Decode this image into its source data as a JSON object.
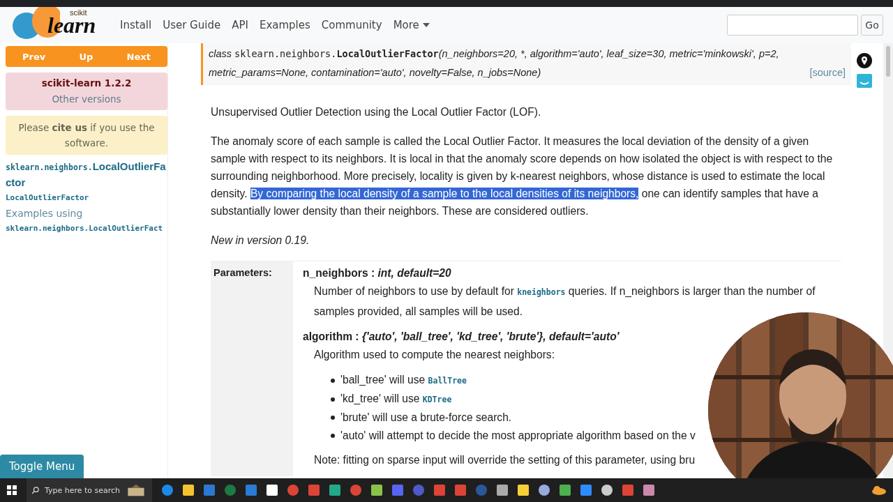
{
  "navbar": {
    "logo": {
      "small": "scikit",
      "big": "learn"
    },
    "links": [
      {
        "label": "Install"
      },
      {
        "label": "User Guide"
      },
      {
        "label": "API"
      },
      {
        "label": "Examples"
      },
      {
        "label": "Community"
      },
      {
        "label": "More",
        "kind": "dropdown"
      }
    ],
    "search": {
      "button": "Go"
    }
  },
  "sidebar": {
    "nav_buttons": [
      "Prev",
      "Up",
      "Next"
    ],
    "version": {
      "title": "scikit-learn 1.2.2",
      "link": "Other versions"
    },
    "cite": "Please **cite us** if you use the software.",
    "toc": [
      {
        "kind": "mixed",
        "mono": "sklearn.neighbors.",
        "text": "LocalOutlierFactor"
      },
      {
        "kind": "code",
        "text": "LocalOutlierFactor"
      },
      {
        "kind": "text",
        "text": "Examples using"
      },
      {
        "kind": "code",
        "text": "sklearn.neighbors.LocalOutlierFact"
      }
    ],
    "toggle": "Toggle Menu"
  },
  "signature": {
    "prefix": "class",
    "module": "sklearn.neighbors.",
    "name": "LocalOutlierFactor",
    "params": "(n_neighbors=20, *, algorithm='auto', leaf_size=30, metric='minkowski', p=2, metric_params=None, contamination='auto', novelty=False, n_jobs=None)",
    "source": "[source]"
  },
  "summary": "Unsupervised Outlier Detection using the Local Outlier Factor (LOF).",
  "description": [
    {
      "text": "The anomaly score of each sample is called the Local Outlier Factor. It measures the local deviation of the density of a given sample with respect to its neighbors. It is local in that the anomaly score depends on how isolated the object is with respect to the surrounding neighborhood. More precisely, locality is given by k-nearest neighbors, whose distance is used to estimate the local density. ",
      "selected": false
    },
    {
      "text": "By comparing the local density of a sample to the local densities of its neighbors,",
      "selected": true
    },
    {
      "text": " one can identify samples that have a substantially lower density than their neighbors. These are considered outliers.",
      "selected": false
    }
  ],
  "version_note": "New in version 0.19.",
  "parameters": {
    "label": "Parameters:",
    "items": [
      {
        "head": "n_neighbors : *int, default=20*",
        "body": [
          {
            "kind": "text",
            "text": "Number of neighbors to use by default for "
          },
          {
            "kind": "code",
            "text": "kneighbors"
          },
          {
            "kind": "text",
            "text": " queries. If n_neighbors is larger than the number of samples provided, all samples will be used."
          }
        ]
      },
      {
        "head": "algorithm : *{'auto', 'ball_tree', 'kd_tree', 'brute'}, default='auto'*",
        "body": [
          {
            "kind": "text",
            "text": "Algorithm used to compute the nearest neighbors:"
          }
        ],
        "bullets": [
          [
            {
              "kind": "text",
              "text": "'ball_tree' will use "
            },
            {
              "kind": "code",
              "text": "BallTree"
            }
          ],
          [
            {
              "kind": "text",
              "text": "'kd_tree' will use "
            },
            {
              "kind": "code",
              "text": "KDTree"
            }
          ],
          [
            {
              "kind": "text",
              "text": "'brute' will use a brute-force search."
            }
          ],
          [
            {
              "kind": "text",
              "text": "'auto' will attempt to decide the most appropriate algorithm based on the v"
            }
          ]
        ],
        "note": "Note: fitting on sparse input will override the setting of this parameter, using bru"
      }
    ]
  },
  "taskbar": {
    "search_placeholder": "Type here to search"
  }
}
